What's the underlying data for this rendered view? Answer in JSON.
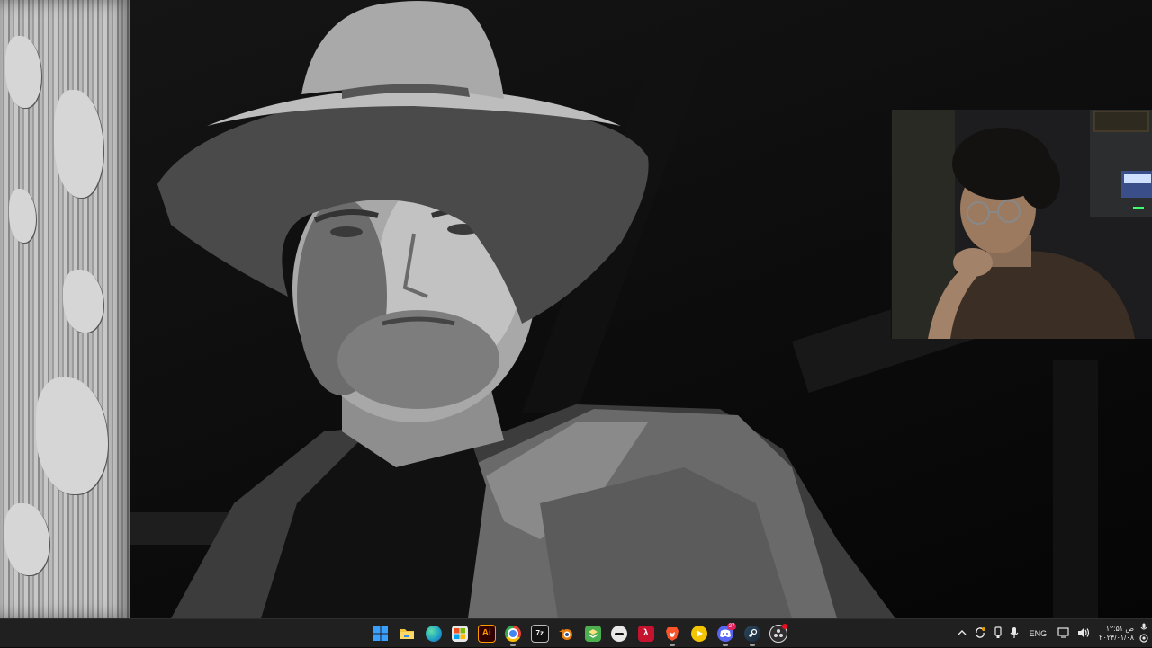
{
  "wallpaper": {
    "subject": "black-and-white portrait of a man in a cowboy hat"
  },
  "webcam": {
    "subject": "streamer webcam overlay"
  },
  "taskbar": {
    "apps": [
      {
        "name": "start",
        "icon": "windows-start-icon",
        "color": "#3aa0ff",
        "glyph": "",
        "state": "none"
      },
      {
        "name": "file-explorer",
        "icon": "folder-icon",
        "color": "#f4c542",
        "glyph": "",
        "state": "none"
      },
      {
        "name": "edge",
        "icon": "edge-icon",
        "color": "#1fa3c4",
        "glyph": "",
        "state": "none"
      },
      {
        "name": "microsoft-store",
        "icon": "store-icon",
        "color": "#2b6cd8",
        "glyph": "",
        "state": "none"
      },
      {
        "name": "illustrator",
        "icon": "illustrator-icon",
        "color": "#330000",
        "glyph": "Ai",
        "state": "none"
      },
      {
        "name": "chrome",
        "icon": "chrome-icon",
        "color": "#34a853",
        "glyph": "",
        "state": "running"
      },
      {
        "name": "7-zip",
        "icon": "7zip-icon",
        "color": "#111111",
        "glyph": "7z",
        "state": "none"
      },
      {
        "name": "blender",
        "icon": "blender-icon",
        "color": "#e87d0d",
        "glyph": "",
        "state": "none"
      },
      {
        "name": "app-green",
        "icon": "layers-icon",
        "color": "#4caf50",
        "glyph": "",
        "state": "none"
      },
      {
        "name": "app-mobile",
        "icon": "more-icon",
        "color": "#e8e8e8",
        "glyph": "",
        "state": "none"
      },
      {
        "name": "app-red",
        "icon": "lambda-icon",
        "color": "#c4122f",
        "glyph": "λ",
        "state": "none"
      },
      {
        "name": "brave",
        "icon": "brave-icon",
        "color": "#fb542b",
        "glyph": "",
        "state": "running"
      },
      {
        "name": "app-yellow",
        "icon": "play-icon",
        "color": "#f5c400",
        "glyph": "",
        "state": "none"
      },
      {
        "name": "discord",
        "icon": "discord-icon",
        "color": "#5865f2",
        "glyph": "",
        "state": "running",
        "badge": "27"
      },
      {
        "name": "steam",
        "icon": "steam-icon",
        "color": "#1b2838",
        "glyph": "",
        "state": "running"
      },
      {
        "name": "obs",
        "icon": "obs-icon",
        "color": "#302e31",
        "glyph": "",
        "state": "active"
      }
    ],
    "tray": {
      "chevron_icon": "chevron-up-icon",
      "sync_icon": "sync-icon",
      "battery_icon": "usb-icon",
      "mic_icon": "microphone-icon",
      "language": "ENG",
      "network_icon": "network-icon",
      "volume_icon": "volume-icon",
      "time": "۱۲:۵۱ ص",
      "date": "۲۰۲۴/۰۱/۰۸",
      "mic_top_icon": "microphone-icon",
      "notification_icon": "notification-icon"
    }
  }
}
